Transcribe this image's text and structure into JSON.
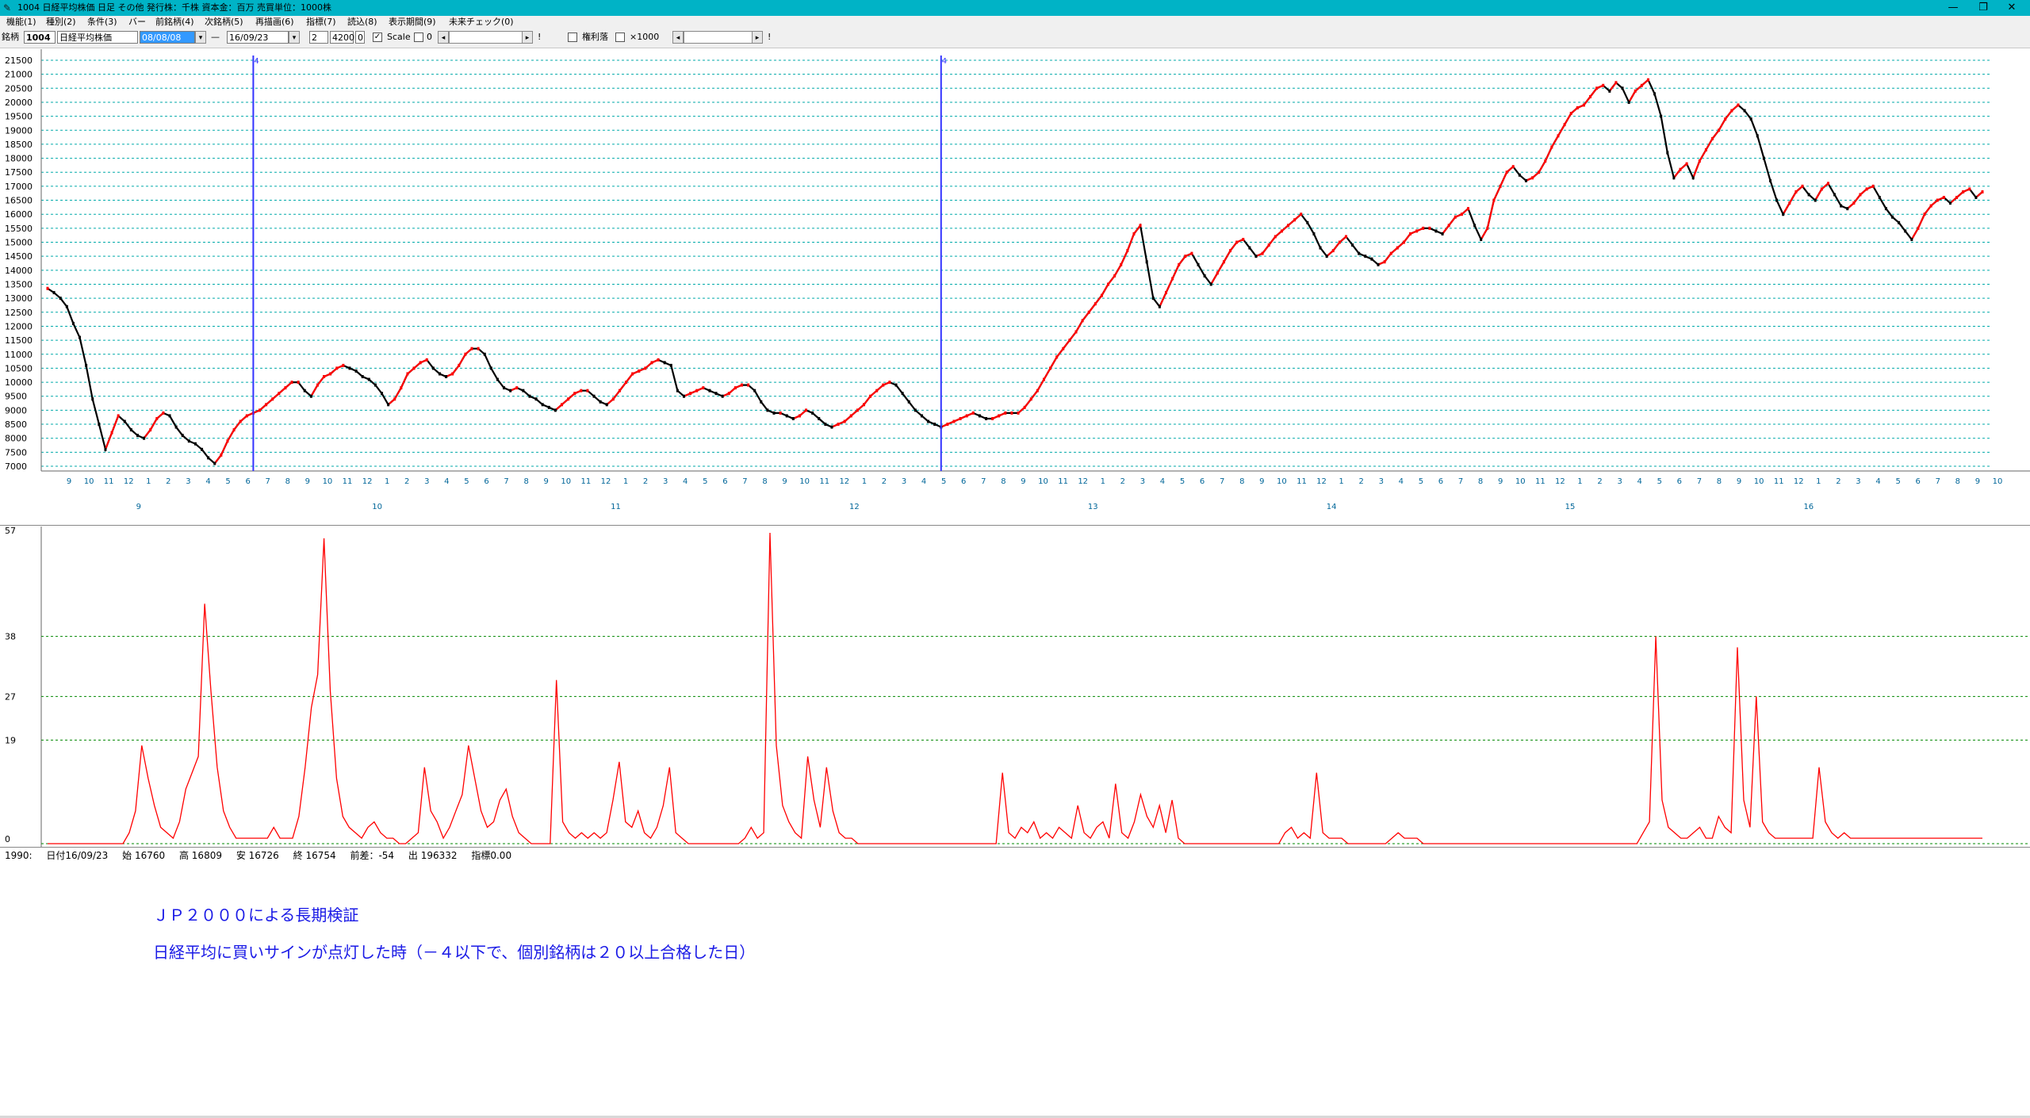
{
  "window": {
    "title": "1004 日経平均株価  日足  その他  発行株：千株  資本金：百万  売買単位：1000株",
    "controls": [
      "—",
      "❐",
      "✕"
    ]
  },
  "menu": [
    "機能(1)",
    "種別(2)",
    "条件(3)",
    "バー",
    "前銘柄(4)",
    "次銘柄(5)",
    "再描画(6)",
    "指標(7)",
    "読込(8)",
    "表示期間(9)",
    "未来チェック(0)"
  ],
  "toolbar": {
    "code_label": "銘柄",
    "code": "1004",
    "name": "日経平均株価",
    "start_date": "08/08/08",
    "separator": "—",
    "end_date": "16/09/23",
    "field_a": "2",
    "field_b": "4200",
    "field_c": "0",
    "scale_label": "Scale",
    "scale_value": "0",
    "rights_label": "権利落",
    "x1000_label": "×1000",
    "marker_1": "!",
    "marker_2": "!"
  },
  "chart_data": [
    {
      "type": "line",
      "series": [
        {
          "values": [
            13350,
            13200,
            13000,
            12700,
            12100,
            11600,
            10600,
            9400,
            8500,
            7600,
            8200,
            8800,
            8600,
            8300,
            8100,
            8000,
            8300,
            8700,
            8900,
            8800,
            8400,
            8100,
            7900,
            7800,
            7600,
            7300,
            7100,
            7400,
            7900,
            8300,
            8600,
            8800,
            8900,
            9000,
            9200,
            9400,
            9600,
            9800,
            10000,
            10000,
            9700,
            9500,
            9900,
            10200,
            10300,
            10500,
            10600,
            10500,
            10400,
            10200,
            10100,
            9900,
            9600,
            9200,
            9400,
            9800,
            10300,
            10500,
            10700,
            10800,
            10500,
            10300,
            10200,
            10300,
            10600,
            11000,
            11200,
            11200,
            11000,
            10500,
            10100,
            9800,
            9700,
            9800,
            9700,
            9500,
            9400,
            9200,
            9100,
            9000,
            9200,
            9400,
            9600,
            9700,
            9700,
            9500,
            9300,
            9200,
            9400,
            9700,
            10000,
            10300,
            10400,
            10500,
            10700,
            10800,
            10700,
            10600,
            9700,
            9500,
            9600,
            9700,
            9800,
            9700,
            9600,
            9500,
            9600,
            9800,
            9900,
            9900,
            9700,
            9300,
            9000,
            8900,
            8900,
            8800,
            8700,
            8800,
            9000,
            8900,
            8700,
            8500,
            8400,
            8500,
            8600,
            8800,
            9000,
            9200,
            9500,
            9700,
            9900,
            10000,
            9900,
            9600,
            9300,
            9000,
            8800,
            8600,
            8500,
            8400,
            8500,
            8600,
            8700,
            8800,
            8900,
            8800,
            8700,
            8700,
            8800,
            8900,
            8900,
            8900,
            9100,
            9400,
            9700,
            10100,
            10500,
            10900,
            11200,
            11500,
            11800,
            12200,
            12500,
            12800,
            13100,
            13500,
            13800,
            14200,
            14700,
            15300,
            15600,
            14300,
            13000,
            12700,
            13200,
            13700,
            14200,
            14500,
            14600,
            14200,
            13800,
            13500,
            13900,
            14300,
            14700,
            15000,
            15100,
            14800,
            14500,
            14600,
            14900,
            15200,
            15400,
            15600,
            15800,
            16000,
            15700,
            15300,
            14800,
            14500,
            14700,
            15000,
            15200,
            14900,
            14600,
            14500,
            14400,
            14200,
            14300,
            14600,
            14800,
            15000,
            15300,
            15400,
            15500,
            15500,
            15400,
            15300,
            15600,
            15900,
            16000,
            16200,
            15600,
            15100,
            15500,
            16500,
            17000,
            17500,
            17700,
            17400,
            17200,
            17300,
            17500,
            17900,
            18400,
            18800,
            19200,
            19600,
            19800,
            19900,
            20200,
            20500,
            20600,
            20400,
            20700,
            20500,
            20000,
            20400,
            20600,
            20800,
            20300,
            19500,
            18200,
            17300,
            17600,
            17800,
            17300,
            17900,
            18300,
            18700,
            19000,
            19400,
            19700,
            19900,
            19700,
            19400,
            18800,
            18000,
            17200,
            16500,
            16000,
            16400,
            16800,
            17000,
            16700,
            16500,
            16900,
            17100,
            16700,
            16300,
            16200,
            16400,
            16700,
            16900,
            17000,
            16600,
            16200,
            15900,
            15700,
            15400,
            15100,
            15500,
            16000,
            16300,
            16500,
            16600,
            16400,
            16600,
            16800,
            16900,
            16600,
            16800
          ]
        }
      ],
      "x_tick_labels": [
        "9",
        "10",
        "11",
        "12",
        "1",
        "2",
        "3",
        "4",
        "5",
        "6",
        "7",
        "8",
        "9",
        "10",
        "11",
        "12",
        "1",
        "2",
        "3",
        "4",
        "5",
        "6",
        "7",
        "8",
        "9",
        "10",
        "11",
        "12",
        "1",
        "2",
        "3",
        "4",
        "5",
        "6",
        "7",
        "8",
        "9",
        "10",
        "11",
        "12",
        "1",
        "2",
        "3",
        "4",
        "5",
        "6",
        "7",
        "8",
        "9",
        "10",
        "11",
        "12",
        "1",
        "2",
        "3",
        "4",
        "5",
        "6",
        "7",
        "8",
        "9",
        "10",
        "11",
        "12",
        "1",
        "2",
        "3",
        "4",
        "5",
        "6",
        "7",
        "8",
        "9",
        "10",
        "11",
        "12",
        "1",
        "2",
        "3",
        "4",
        "5",
        "6",
        "7",
        "8",
        "9",
        "10",
        "11",
        "12",
        "1",
        "2",
        "3",
        "4",
        "5",
        "6",
        "7",
        "8",
        "9",
        "10"
      ],
      "year_labels": [
        "9",
        "10",
        "11",
        "12",
        "13",
        "14",
        "15",
        "16"
      ],
      "ylim": [
        7000,
        21500
      ],
      "y_ticks": [
        7000,
        7500,
        8000,
        8500,
        9000,
        9500,
        10000,
        10500,
        11000,
        11500,
        12000,
        12500,
        13000,
        13500,
        14000,
        14500,
        15000,
        15500,
        16000,
        16500,
        17000,
        17500,
        18000,
        18500,
        19000,
        19500,
        20000,
        20500,
        21000,
        21500
      ],
      "signal_markers": [
        {
          "x_index": 32,
          "label": "4"
        },
        {
          "x_index": 139,
          "label": "4"
        },
        {
          "x_index": 414,
          "label": "4"
        },
        {
          "x_index": 417,
          "label": "4"
        }
      ],
      "grid": true,
      "colors": {
        "up": "#ff0000",
        "down": "#000000",
        "grid": "#00aaaa",
        "marker": "#3333ff",
        "axis_text": "#006699"
      }
    },
    {
      "type": "line",
      "series": [
        {
          "values": [
            0,
            0,
            0,
            0,
            0,
            0,
            0,
            0,
            0,
            0,
            0,
            0,
            0,
            2,
            6,
            18,
            12,
            7,
            3,
            2,
            1,
            4,
            10,
            13,
            16,
            44,
            28,
            14,
            6,
            3,
            1,
            1,
            1,
            1,
            1,
            1,
            3,
            1,
            1,
            1,
            5,
            14,
            25,
            31,
            56,
            28,
            12,
            5,
            3,
            2,
            1,
            3,
            4,
            2,
            1,
            1,
            0,
            0,
            1,
            2,
            14,
            6,
            4,
            1,
            3,
            6,
            9,
            18,
            12,
            6,
            3,
            4,
            8,
            10,
            5,
            2,
            1,
            0,
            0,
            0,
            0,
            30,
            4,
            2,
            1,
            2,
            1,
            2,
            1,
            2,
            8,
            15,
            4,
            3,
            6,
            2,
            1,
            3,
            7,
            14,
            2,
            1,
            0,
            0,
            0,
            0,
            0,
            0,
            0,
            0,
            0,
            1,
            3,
            1,
            2,
            57,
            18,
            7,
            4,
            2,
            1,
            16,
            8,
            3,
            14,
            6,
            2,
            1,
            1,
            0,
            0,
            0,
            0,
            0,
            0,
            0,
            0,
            0,
            0,
            0,
            0,
            0,
            0,
            0,
            0,
            0,
            0,
            0,
            0,
            0,
            0,
            0,
            13,
            2,
            1,
            3,
            2,
            4,
            1,
            2,
            1,
            3,
            2,
            1,
            7,
            2,
            1,
            3,
            4,
            1,
            11,
            2,
            1,
            4,
            9,
            5,
            3,
            7,
            2,
            8,
            1,
            0,
            0,
            0,
            0,
            0,
            0,
            0,
            0,
            0,
            0,
            0,
            0,
            0,
            0,
            0,
            0,
            2,
            3,
            1,
            2,
            1,
            13,
            2,
            1,
            1,
            1,
            0,
            0,
            0,
            0,
            0,
            0,
            0,
            1,
            2,
            1,
            1,
            1,
            0,
            0,
            0,
            0,
            0,
            0,
            0,
            0,
            0,
            0,
            0,
            0,
            0,
            0,
            0,
            0,
            0,
            0,
            0,
            0,
            0,
            0,
            0,
            0,
            0,
            0,
            0,
            0,
            0,
            0,
            0,
            0,
            0,
            0,
            0,
            2,
            4,
            38,
            8,
            3,
            2,
            1,
            1,
            2,
            3,
            1,
            1,
            5,
            3,
            2,
            36,
            8,
            3,
            27,
            4,
            2,
            1,
            1,
            1,
            1,
            1,
            1,
            1,
            14,
            4,
            2,
            1,
            2,
            1,
            1,
            1,
            1,
            1,
            1,
            1,
            1,
            1,
            1,
            1,
            1,
            1,
            1,
            1,
            1,
            1,
            1,
            1,
            1,
            1,
            1
          ]
        }
      ],
      "y_ticks": [
        0,
        19,
        27,
        38
      ],
      "top_tick_label": "57",
      "grid": true,
      "colors": {
        "line": "#ff0000",
        "grid": "#008800"
      }
    }
  ],
  "status": {
    "prefix": "1990:",
    "date": "日付16/09/23",
    "open": "始 16760",
    "high": "高 16809",
    "low": "安 16726",
    "close": "終 16754",
    "diff": "前差：-54",
    "volume": "出 196332",
    "index": "指標0.00"
  },
  "captions": {
    "line1": "ＪＰ２０００による長期検証",
    "line2": "日経平均に買いサインが点灯した時（－４以下で、個別銘柄は２０以上合格した日）"
  }
}
